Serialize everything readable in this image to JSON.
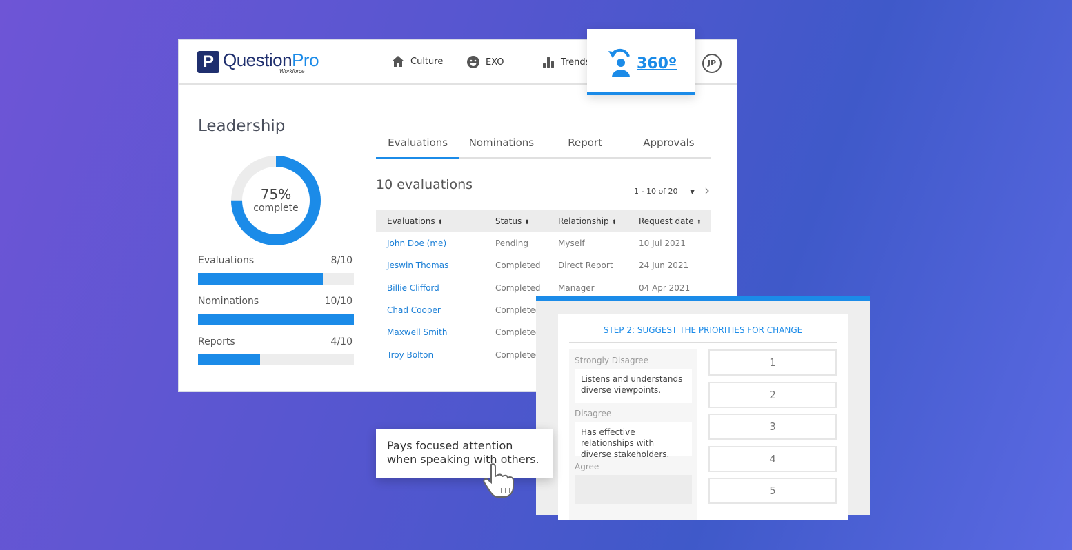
{
  "brand": {
    "logo_glyph": "P",
    "name_a": "Question",
    "name_b": "Pro",
    "sub": "Workforce"
  },
  "nav": [
    {
      "label": "Culture",
      "icon": "home-icon"
    },
    {
      "label": "EXO",
      "icon": "smiley-icon"
    },
    {
      "label": "Trends",
      "icon": "bar-chart-icon"
    }
  ],
  "badge": {
    "label": "360º",
    "icon": "person-rotate-icon"
  },
  "user": {
    "initials": "JP"
  },
  "sidebar": {
    "title": "Leadership",
    "progress_percent": 75,
    "pct_label": "75%",
    "pct_sub": "complete",
    "bars": [
      {
        "label": "Evaluations",
        "value": "8/10",
        "fraction": 0.8
      },
      {
        "label": "Nominations",
        "value": "10/10",
        "fraction": 1.0
      },
      {
        "label": "Reports",
        "value": "4/10",
        "fraction": 0.4
      }
    ]
  },
  "tabs": [
    {
      "label": "Evaluations",
      "active": true
    },
    {
      "label": "Nominations"
    },
    {
      "label": "Report"
    },
    {
      "label": "Approvals"
    }
  ],
  "table": {
    "count": "10 evaluations",
    "pager": "1 - 10 of 20",
    "headers": [
      "Evaluations",
      "Status",
      "Relationship",
      "Request date"
    ],
    "rows": [
      [
        "John Doe (me)",
        "Pending",
        "Myself",
        "10 Jul 2021"
      ],
      [
        "Jeswin Thomas",
        "Completed",
        "Direct Report",
        "24 Jun 2021"
      ],
      [
        "Billie Clifford",
        "Completed",
        "Manager",
        "04 Apr 2021"
      ],
      [
        "Chad Cooper",
        "Completed",
        "",
        ""
      ],
      [
        "Maxwell Smith",
        "Completed",
        "",
        ""
      ],
      [
        "Troy Bolton",
        "Completed",
        "",
        ""
      ]
    ]
  },
  "survey": {
    "step": "STEP 2: SUGGEST THE PRIORITIES FOR CHANGE",
    "groups": [
      {
        "label": "Strongly Disagree",
        "item": "Listens and understands diverse viewpoints."
      },
      {
        "label": "Disagree",
        "item": "Has effective relationships with diverse stakeholders."
      },
      {
        "label": "Agree",
        "item": ""
      }
    ],
    "ranks": [
      "1",
      "2",
      "3",
      "4",
      "5"
    ]
  },
  "drag_item": "Pays focused attention when speaking with others.",
  "colors": {
    "accent": "#1b8be8",
    "brand": "#1f2f6e"
  }
}
